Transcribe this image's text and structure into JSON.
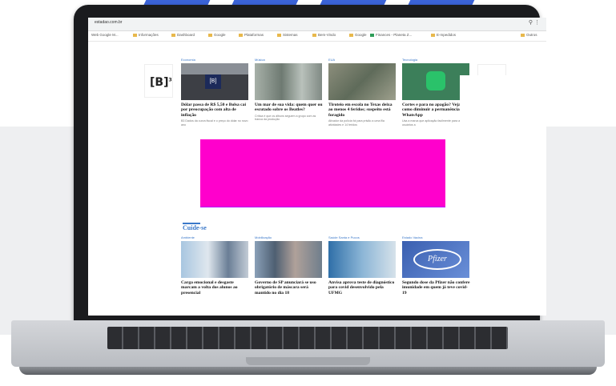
{
  "colors": {
    "accent": "#3a78c9",
    "placeholder": "#ff00cc",
    "brand_stripe": "#3b63d8"
  },
  "browser": {
    "url": "estadao.com.br",
    "bookmarks": [
      "Web Google M...",
      "Informações",
      "Dashboard",
      "Google",
      "Plataformas",
      "Sistemas",
      "Bem-Vindo",
      "Google",
      "Finances - Planeta Z...",
      "E-mpedidos",
      "Outros"
    ]
  },
  "ads": {
    "brand": "[B]",
    "sup": "3"
  },
  "top_cards": [
    {
      "tag": "Economia",
      "title": "Dólar passa de R$ 5,50 e Bolsa cai por preocupação com alta de inflação",
      "sub": "B3 Dados da curva fiscal e o preço do dólar no novo ano"
    },
    {
      "tag": "Música",
      "title": "Um mar de sua vida: quem quer ou escutado sobre os Beatles?",
      "sub": "Crítica é que os álbuns seguem a grupo com as tranca da produção"
    },
    {
      "tag": "EUA",
      "title": "Tiroteio em escola no Texas deixa ao menos 4 feridos; suspeito está foragido",
      "sub": "Ativador da polícia foi para prisão a uma fila atividades e 14 feridos"
    },
    {
      "tag": "Tecnologia",
      "title": "Cortes e para no apagão? Veja como diminuir a permanência no WhatsApp",
      "sub": "Usa a marca que aplicação facilmente para ajudar os usuários a"
    }
  ],
  "section_title": "Cuide-se",
  "bottom_cards": [
    {
      "tag": "Ambiente",
      "title": "Carga emocional e desgaste marcam a volta dos alunos ao presencial"
    },
    {
      "tag": "Mobilização",
      "title": "Governo de SP anunciará se uso obrigatório de máscara será mantido no dia 18"
    },
    {
      "tag": "Saúde Santa e Pucos",
      "title": "Anvisa aprova teste de diagnóstico para covid desenvolvido pela UFMG"
    },
    {
      "tag": "Estado Vacina",
      "title": "Segundo dose da Pfizer não confere imunidade em quem já teve covid-19"
    }
  ],
  "pfizer_logo": "Pfizer"
}
